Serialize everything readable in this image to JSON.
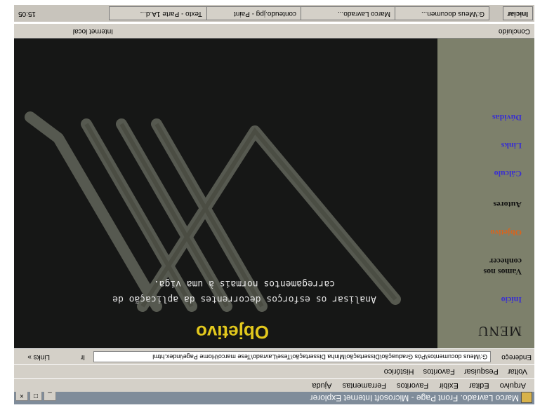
{
  "window": {
    "title": "Marco Lavrado. Front Page - Microsoft Internet Explorer"
  },
  "menubar": [
    "Arquivo",
    "Editar",
    "Exibir",
    "Favoritos",
    "Ferramentas",
    "Ajuda"
  ],
  "toolbar": [
    "Voltar",
    "Pesquisar",
    "Favoritos",
    "Histórico"
  ],
  "address": {
    "label": "Endereço",
    "value": "G:\\Meus documentos\\Pós Graduação\\Dissertação\\Minha Dissertação\\Tese\\Lavrado\\Tese marco\\Home Page\\index.html",
    "go": "Ir",
    "links": "Links »"
  },
  "sidebar": {
    "title": "MENU",
    "items": [
      {
        "label": "Início",
        "color": "#3a2fd0"
      },
      {
        "label": "Vamos nos conhecer",
        "color": "#111111"
      },
      {
        "label": "Objetivo",
        "color": "#d8641e"
      },
      {
        "label": "Autores",
        "color": "#111111"
      },
      {
        "label": "Cálculo",
        "color": "#3a2fd0"
      },
      {
        "label": "Links",
        "color": "#3a2fd0"
      },
      {
        "label": "Dúvidas",
        "color": "#3a2fd0"
      }
    ]
  },
  "content": {
    "heading": "Objetivo",
    "text": "Analisar os esforços decorrentes da aplicação de carregamentos normais à uma viga."
  },
  "status": {
    "left": "Concluído",
    "zone": "Internet local"
  },
  "taskbar": {
    "start": "Iniciar",
    "tasks": [
      "G:\\Meus documen...",
      "Marco Lavrado...",
      "conteudo.jpg - Paint",
      "Texto - Parte 1A.d..."
    ],
    "clock": "15:05"
  },
  "colors": {
    "accent": "#e2c81d",
    "sidebar": "#7d806b",
    "content_bg": "#161716"
  }
}
